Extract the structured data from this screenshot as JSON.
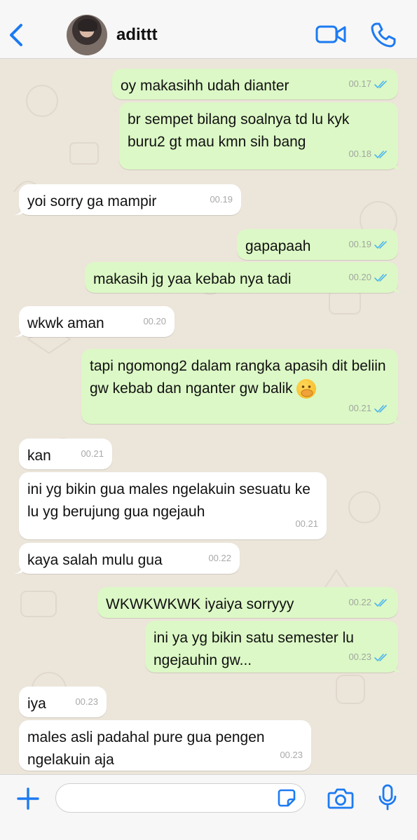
{
  "header": {
    "contact_name": "adittt"
  },
  "colors": {
    "accent": "#1d7af2",
    "outgoing_bubble": "#dcf8c6",
    "incoming_bubble": "#ffffff",
    "read_tick": "#4fb6ec",
    "chat_background": "#ece5da"
  },
  "icons": {
    "back": "chevron-left",
    "video": "video-camera",
    "call": "phone",
    "add": "plus",
    "sticker": "sticker",
    "camera": "camera",
    "mic": "microphone"
  },
  "messages": [
    {
      "dir": "out",
      "text": "oy makasihh udah dianter",
      "time": "00.17",
      "read": true
    },
    {
      "dir": "out",
      "text": "br sempet bilang soalnya td lu kyk buru2 gt mau kmn sih bang",
      "time": "00.18",
      "read": true
    },
    {
      "dir": "in",
      "text": "yoi sorry ga mampir",
      "time": "00.19"
    },
    {
      "dir": "out",
      "text": "gapapaah",
      "time": "00.19",
      "read": true
    },
    {
      "dir": "out",
      "text": "makasih jg yaa kebab nya tadi",
      "time": "00.20",
      "read": true
    },
    {
      "dir": "in",
      "text": "wkwk aman",
      "time": "00.20"
    },
    {
      "dir": "out",
      "text": "tapi ngomong2 dalam rangka apasih dit beliin gw kebab dan nganter gw balik",
      "time": "00.21",
      "read": true,
      "emoji": "face-with-hand-over-mouth"
    },
    {
      "dir": "in",
      "text": "kan",
      "time": "00.21"
    },
    {
      "dir": "in",
      "text": "ini yg bikin gua males ngelakuin sesuatu ke lu yg berujung gua ngejauh",
      "time": "00.21"
    },
    {
      "dir": "in",
      "text": "kaya salah mulu gua",
      "time": "00.22"
    },
    {
      "dir": "out",
      "text": "WKWKWKWK iyaiya sorryyy",
      "time": "00.22",
      "read": true
    },
    {
      "dir": "out",
      "text": "ini ya yg bikin satu semester lu ngejauhin gw...",
      "time": "00.23",
      "read": true
    },
    {
      "dir": "in",
      "text": "iya",
      "time": "00.23"
    },
    {
      "dir": "in",
      "text": "males asli padahal pure gua pengen ngelakuin aja",
      "time": "00.23"
    }
  ],
  "composer": {
    "input_value": ""
  }
}
